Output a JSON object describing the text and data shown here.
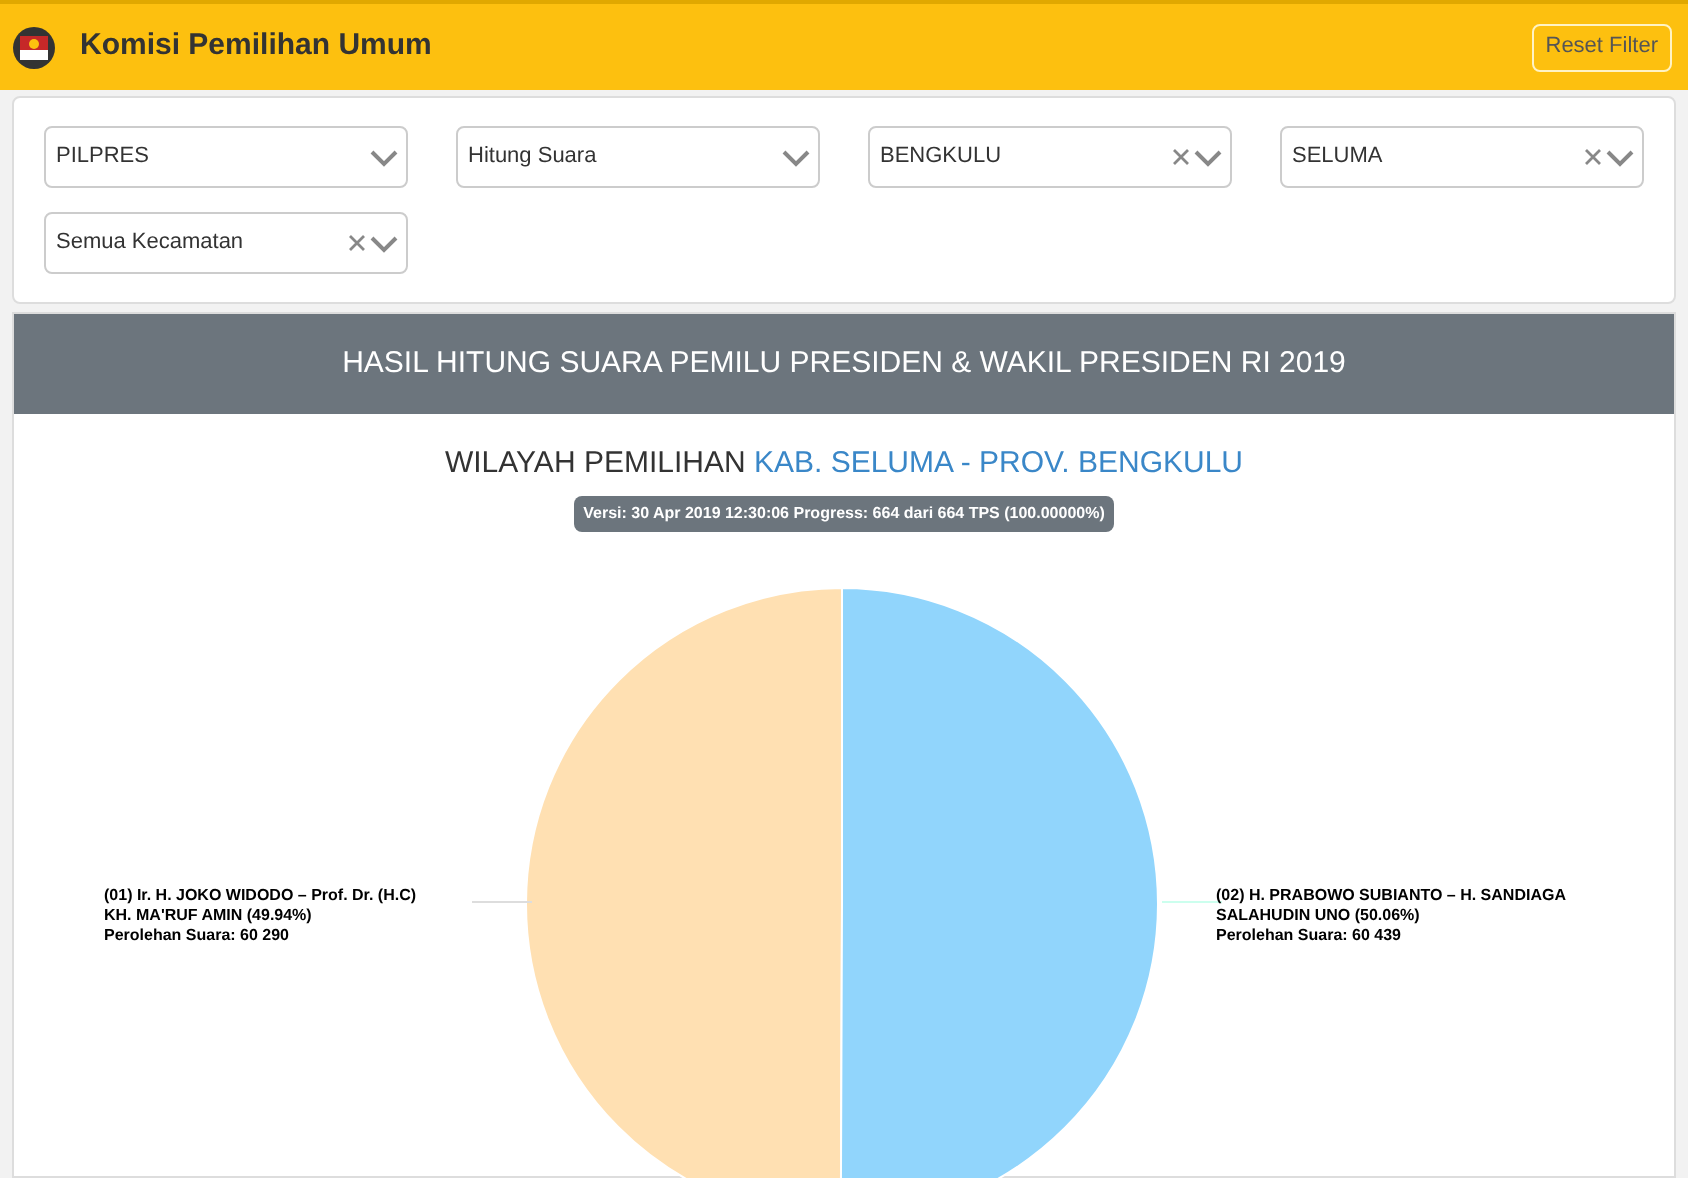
{
  "header": {
    "title": "Komisi Pemilihan Umum",
    "reset_button": "Reset Filter"
  },
  "filters": [
    {
      "value": "PILPRES",
      "clearable": false
    },
    {
      "value": "Hitung Suara",
      "clearable": false
    },
    {
      "value": "BENGKULU",
      "clearable": true
    },
    {
      "value": "SELUMA",
      "clearable": true
    },
    {
      "value": "Semua Kecamatan",
      "clearable": true
    }
  ],
  "panel": {
    "title": "HASIL HITUNG SUARA PEMILU PRESIDEN & WAKIL PRESIDEN RI 2019",
    "region_label": "WILAYAH PEMILIHAN",
    "region_value": "KAB. SELUMA - PROV. BENGKULU",
    "version_badge": "Versi: 30 Apr 2019 12:30:06 Progress: 664 dari 664 TPS (100.00000%)",
    "slice_labels": [
      {
        "name": "(01) Ir. H. JOKO WIDODO – Prof. Dr. (H.C) KH. MA'RUF AMIN (49.94%)",
        "votes": "Perolehan Suara: 60 290"
      },
      {
        "name": "(02) H. PRABOWO SUBIANTO – H. SANDIAGA SALAHUDIN UNO (50.06%)",
        "votes": "Perolehan Suara: 60 439"
      }
    ],
    "chart_data": {
      "type": "pie",
      "values": [
        49.94,
        50.06
      ],
      "colors": [
        "#ffe0b2",
        "#91d5fc"
      ]
    }
  }
}
